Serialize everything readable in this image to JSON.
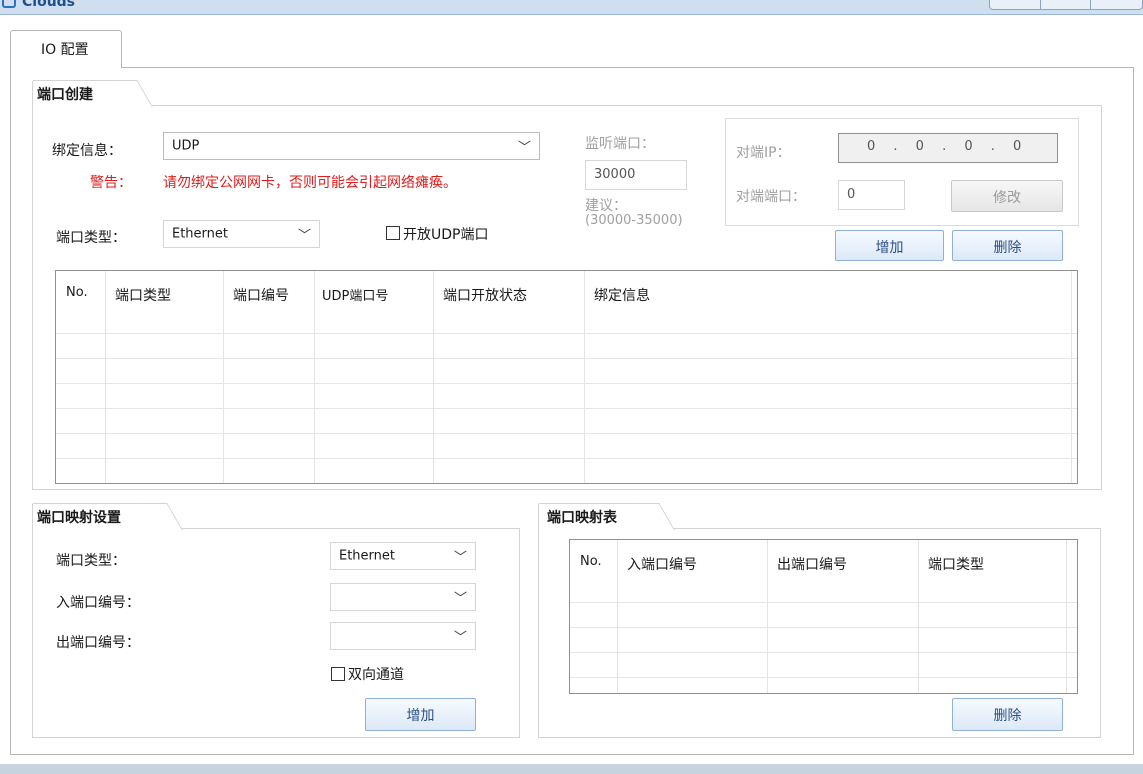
{
  "window": {
    "title": "Clouds"
  },
  "tabs": [
    {
      "label": "IO 配置",
      "active": true
    }
  ],
  "port_create": {
    "title": "端口创建",
    "bind_label": "绑定信息：",
    "bind_value": "UDP",
    "warning_label": "警告：",
    "warning_text": "请勿绑定公网网卡，否则可能会引起网络瘫痪。",
    "port_type_label": "端口类型：",
    "port_type_value": "Ethernet",
    "open_udp_label": "开放UDP端口",
    "open_udp_checked": false,
    "listen_port_label": "监听端口：",
    "listen_port_value": "30000",
    "suggest_label": "建议：",
    "suggest_range": "(30000-35000)",
    "peer_ip_label": "对端IP：",
    "peer_ip_value": "0  .  0  .  0  .  0",
    "peer_port_label": "对端端口：",
    "peer_port_value": "0",
    "modify_button": "修改",
    "add_button": "增加",
    "delete_button": "删除",
    "table_headers": [
      "No.",
      "端口类型",
      "端口编号",
      "UDP端口号",
      "端口开放状态",
      "绑定信息"
    ],
    "rows": []
  },
  "port_mapping_settings": {
    "title": "端口映射设置",
    "port_type_label": "端口类型：",
    "port_type_value": "Ethernet",
    "in_port_label": "入端口编号：",
    "in_port_value": "",
    "out_port_label": "出端口编号：",
    "out_port_value": "",
    "bidirectional_label": "双向通道",
    "bidirectional_checked": false,
    "add_button": "增加"
  },
  "port_mapping_table": {
    "title": "端口映射表",
    "table_headers": [
      "No.",
      "入端口编号",
      "出端口编号",
      "端口类型"
    ],
    "rows": [],
    "delete_button": "删除"
  },
  "colors": {
    "warning": "#e21b1b",
    "button_text": "#2a4f86",
    "accent": "#2d6fc2"
  },
  "icons": {
    "app": "clouds-app-icon",
    "chevron": "chevron-down-icon"
  }
}
